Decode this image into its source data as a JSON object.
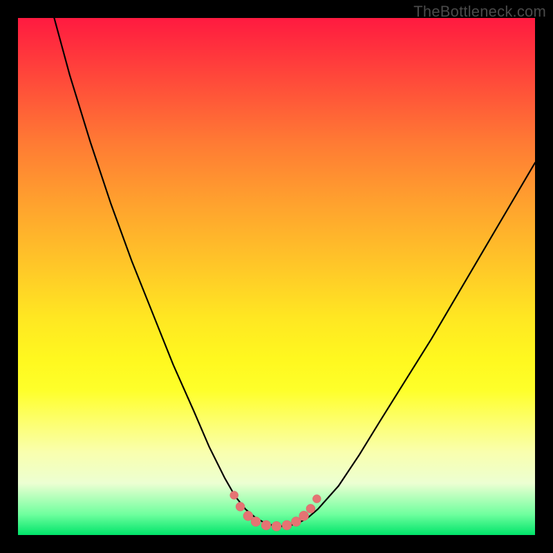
{
  "watermark": "TheBottleneck.com",
  "colors": {
    "background": "#000000",
    "curve_stroke": "#000000",
    "marker_fill": "#e57373",
    "marker_stroke": "#d46a6a"
  },
  "chart_data": {
    "type": "line",
    "title": "",
    "xlabel": "",
    "ylabel": "",
    "xlim": [
      0,
      100
    ],
    "ylim": [
      0,
      100
    ],
    "grid": false,
    "legend": false,
    "note": "Values estimated from pixel positions on an unlabeled axis. Y uses screen-down convention (0=top, 100=bottom).",
    "series": [
      {
        "name": "main-curve",
        "x": [
          7,
          10,
          14,
          18,
          22,
          26,
          30,
          34,
          37,
          40,
          42,
          44,
          46,
          48,
          50,
          52,
          54,
          56,
          58,
          62,
          66,
          70,
          75,
          80,
          85,
          90,
          95,
          100
        ],
        "y": [
          0,
          11,
          24,
          36,
          47,
          57,
          67,
          76,
          83,
          89,
          92.5,
          95,
          96.7,
          97.8,
          98.3,
          98.3,
          97.8,
          96.7,
          95,
          90.5,
          84.5,
          78,
          70,
          62,
          53.5,
          45,
          36.5,
          28
        ]
      }
    ],
    "markers": {
      "name": "bottom-highlight-dots",
      "x": [
        41.8,
        43.0,
        44.5,
        46.0,
        48.0,
        50.0,
        52.0,
        53.8,
        55.3,
        56.6,
        57.8
      ],
      "y": [
        92.3,
        94.5,
        96.3,
        97.4,
        98.1,
        98.3,
        98.1,
        97.4,
        96.3,
        94.9,
        93.0
      ],
      "r": [
        6,
        6.5,
        7,
        7,
        7,
        7,
        7,
        7,
        7,
        6.5,
        6
      ]
    }
  }
}
